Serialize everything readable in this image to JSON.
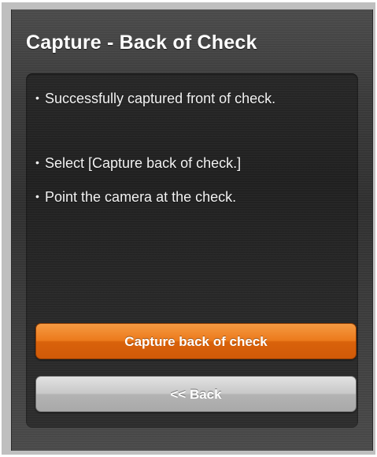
{
  "screen": {
    "title": "Capture - Back of Check"
  },
  "instructions": [
    "Successfully captured front of check.",
    "Select [Capture back of check.]",
    "Point the camera at the check."
  ],
  "bullet": "•",
  "buttons": {
    "capture_label": "Capture back of check",
    "back_label": "<< Back"
  },
  "colors": {
    "accent": "#ec7a1c",
    "secondary_button": "#bdbdbd",
    "background": "#333333",
    "text": "#ffffff"
  }
}
